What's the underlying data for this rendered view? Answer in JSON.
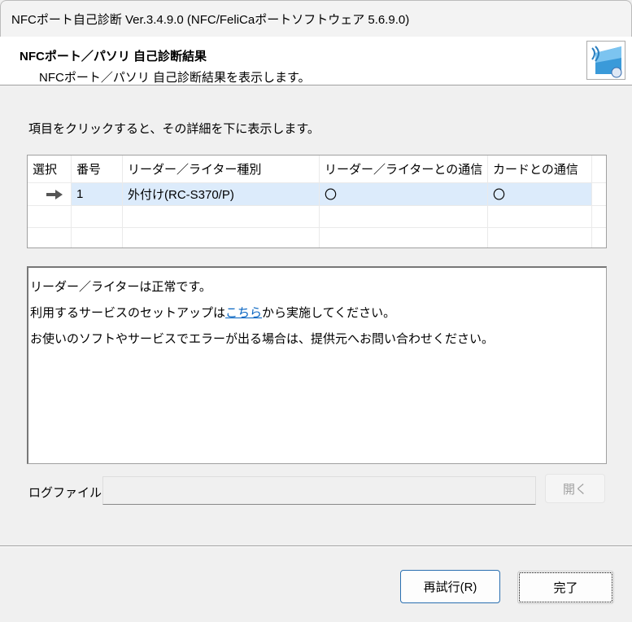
{
  "window": {
    "title": "NFCポート自己診断 Ver.3.4.9.0 (NFC/FeliCaポートソフトウェア 5.6.9.0)"
  },
  "header": {
    "title": "NFCポート／パソリ 自己診断結果",
    "subtitle": "NFCポート／パソリ 自己診断結果を表示します。",
    "icon": "nfc-reader-icon"
  },
  "instruction": "項目をクリックすると、その詳細を下に表示します。",
  "table": {
    "columns": [
      "選択",
      "番号",
      "リーダー／ライター種別",
      "リーダー／ライターとの通信",
      "カードとの通信"
    ],
    "rows": [
      {
        "selected_icon": "arrow-right-icon",
        "number": "1",
        "type": "外付け(RC-S370/P)",
        "reader_comm": "〇",
        "card_comm": "〇"
      }
    ]
  },
  "detail": {
    "line1": "リーダー／ライターは正常です。",
    "line2_pre": "利用するサービスのセットアップは",
    "line2_link": "こちら",
    "line2_post": "から実施してください。",
    "line3": "お使いのソフトやサービスでエラーが出る場合は、提供元へお問い合わせください。"
  },
  "log": {
    "label": "ログファイル",
    "value": "",
    "open_label": "開く"
  },
  "buttons": {
    "retry": "再試行(R)",
    "done": "完了"
  }
}
